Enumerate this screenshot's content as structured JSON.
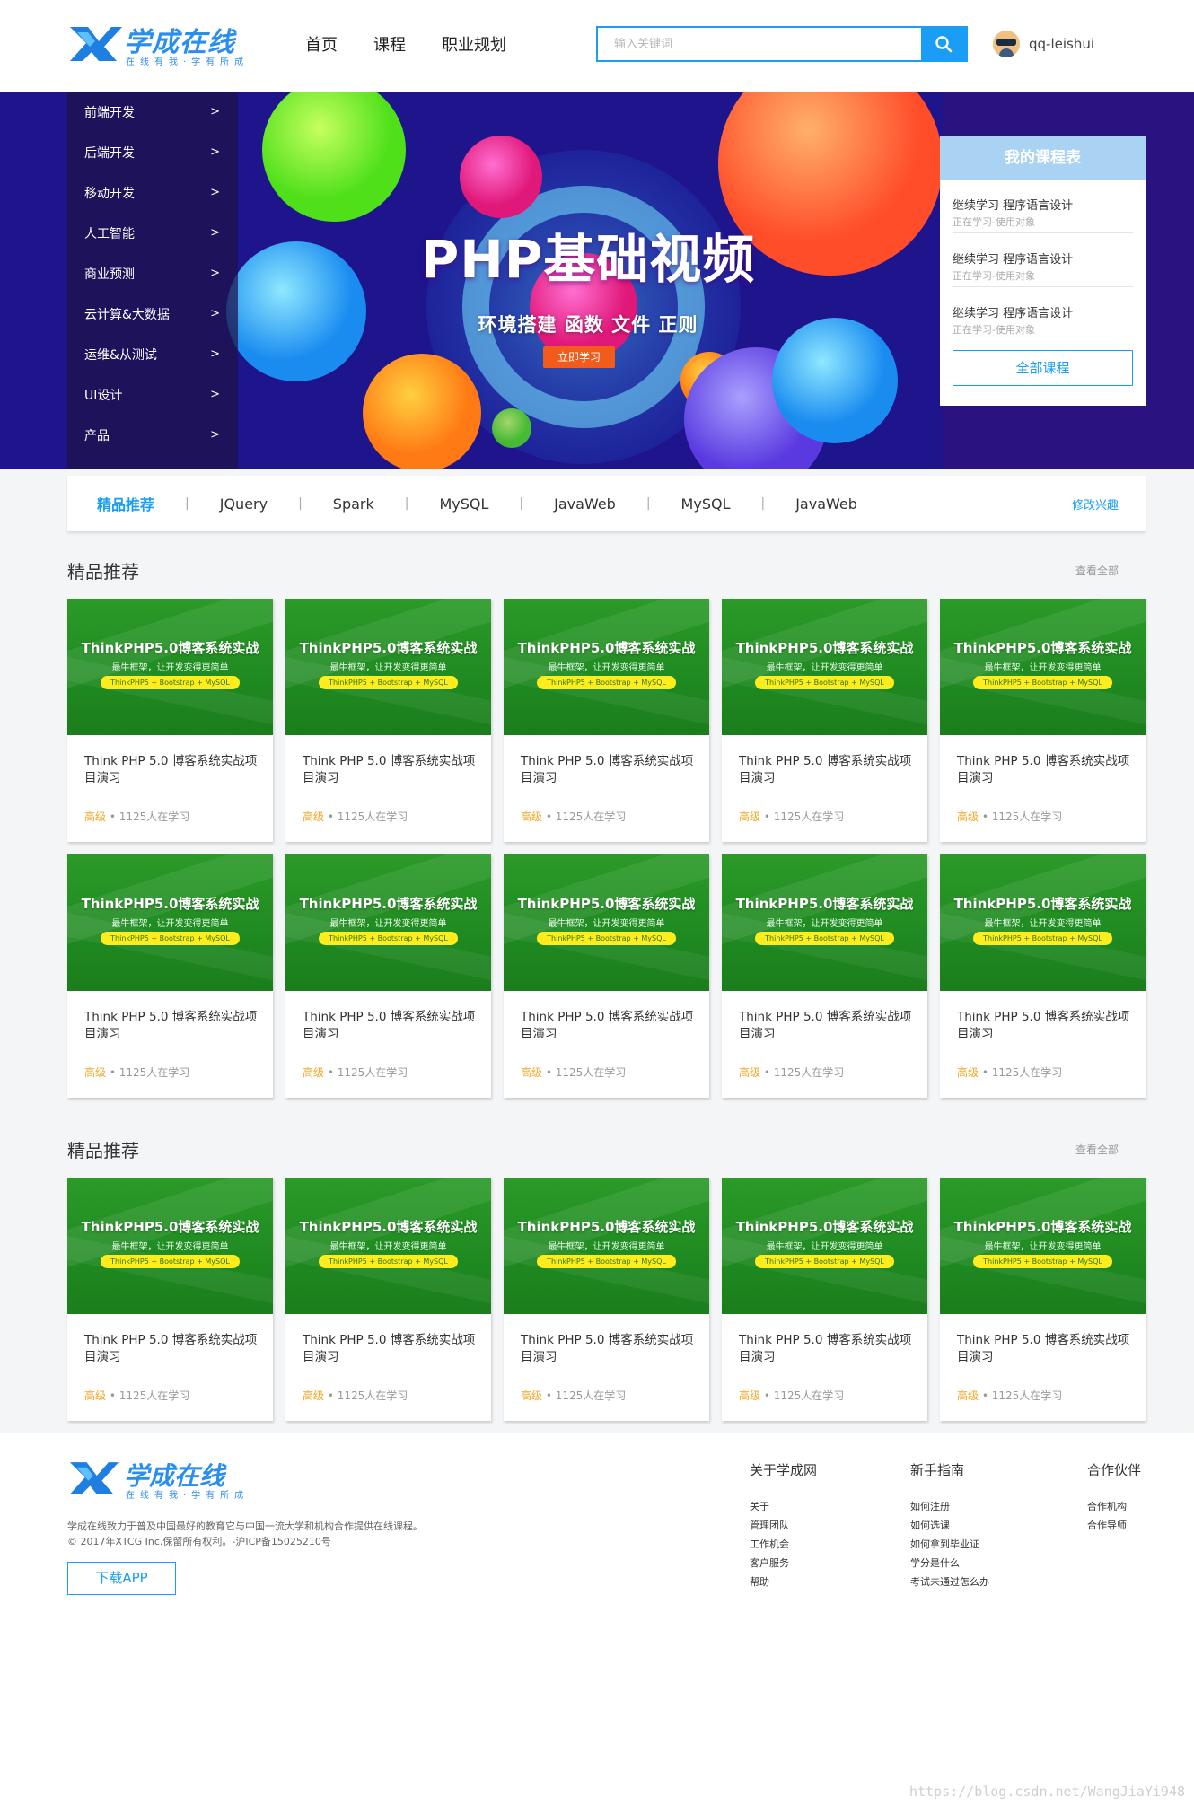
{
  "header": {
    "logo_title": "学成在线",
    "logo_slogan": "在线有我·学有所成",
    "nav": [
      "首页",
      "课程",
      "职业规划"
    ],
    "search_placeholder": "输入关键词",
    "username": "qq-leishui"
  },
  "banner": {
    "menu": [
      "前端开发",
      "后端开发",
      "移动开发",
      "人工智能",
      "商业预测",
      "云计算&大数据",
      "运维&从测试",
      "UI设计",
      "产品"
    ],
    "arrow": ">",
    "title": "PHP基础视频",
    "subtitle": "环境搭建  函数  文件  正则",
    "cta": "立即学习",
    "schedule": {
      "title": "我的课程表",
      "items": [
        {
          "name": "继续学习 程序语言设计",
          "status": "正在学习-使用对象"
        },
        {
          "name": "继续学习 程序语言设计",
          "status": "正在学习-使用对象"
        },
        {
          "name": "继续学习 程序语言设计",
          "status": "正在学习-使用对象"
        }
      ],
      "all_label": "全部课程"
    }
  },
  "categories": {
    "tabs": [
      "精品推荐",
      "JQuery",
      "Spark",
      "MySQL",
      "JavaWeb",
      "MySQL",
      "JavaWeb"
    ],
    "separator": "|",
    "edit_label": "修改兴趣"
  },
  "sections": [
    {
      "title": "精品推荐",
      "view_all": "查看全部",
      "rows": 2
    },
    {
      "title": "精品推荐",
      "view_all": "查看全部",
      "rows": 1
    }
  ],
  "course": {
    "thumb_title": "ThinkPHP5.0博客系统实战",
    "thumb_sub": "最牛框架，让开发变得更简单",
    "thumb_tag": "ThinkPHP5 + Bootstrap + MySQL",
    "name": "Think PHP 5.0 博客系统实战项目演习",
    "level": "高级",
    "dot": " • ",
    "learners": "1125人在学习"
  },
  "footer": {
    "desc_line1": "学成在线致力于普及中国最好的教育它与中国一流大学和机构合作提供在线课程。",
    "desc_line2": "© 2017年XTCG Inc.保留所有权利。-沪ICP备15025210号",
    "app_button": "下载APP",
    "columns": [
      {
        "title": "关于学成网",
        "links": [
          "关于",
          "管理团队",
          "工作机会",
          "客户服务",
          "帮助"
        ]
      },
      {
        "title": "新手指南",
        "links": [
          "如何注册",
          "如何选课",
          "如何拿到毕业证",
          "学分是什么",
          "考试未通过怎么办"
        ]
      },
      {
        "title": "合作伙伴",
        "links": [
          "合作机构",
          "合作导师"
        ]
      }
    ]
  },
  "watermark": "https://blog.csdn.net/WangJiaYi948",
  "colors": {
    "accent": "#1a9ef5",
    "banner_bg": "#2a1280",
    "cta": "#f25b1c",
    "level": "#f5a623",
    "thumb_green": "#1f8a21"
  }
}
